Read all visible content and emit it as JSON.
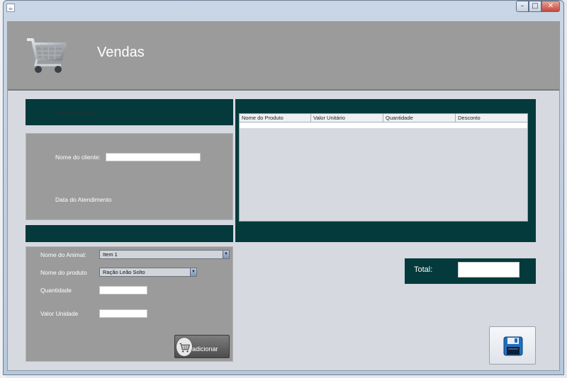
{
  "window": {
    "title_bar_text": "",
    "buttons": {
      "minimize": "–",
      "maximize": "□",
      "close": "✕"
    }
  },
  "header": {
    "title": "Vendas",
    "logo_icon": "shopping-cart-icon"
  },
  "vendas_panel": {
    "label": "Vendas Pessoa"
  },
  "cliente_panel": {
    "nome_label": "Nome do cliente:",
    "nome_value": "",
    "data_label": "Data do Atendimento"
  },
  "produto_panel": {
    "animal_label": "Nome do Animal:",
    "animal_selected": "Item 1",
    "produto_label": "Nome do produto",
    "produto_selected": "Ração Leão Solto",
    "quantidade_label": "Quantidade",
    "quantidade_value": "",
    "valor_label": "Valor Unidade",
    "valor_value": "",
    "add_button_label": "adicionar",
    "add_button_icon": "add-to-cart-icon"
  },
  "table": {
    "columns": [
      "Nome do Produto",
      "Valor Unitário",
      "Quantidade",
      "Desconto"
    ],
    "rows": []
  },
  "total": {
    "label": "Total:",
    "value": ""
  },
  "save_button": {
    "icon": "floppy-disk-icon"
  },
  "colors": {
    "dark_panel": "#043a3b",
    "gray_panel": "#9b9b9b",
    "background": "#d6d9e0"
  }
}
